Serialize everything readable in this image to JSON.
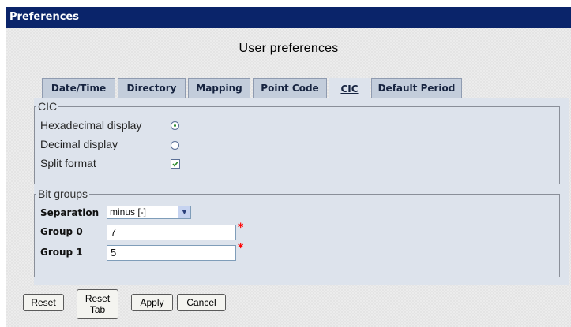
{
  "window": {
    "title": "Preferences"
  },
  "page": {
    "title": "User preferences"
  },
  "tabs": [
    {
      "label": "Date/Time",
      "active": false
    },
    {
      "label": "Directory",
      "active": false
    },
    {
      "label": "Mapping",
      "active": false
    },
    {
      "label": "Point Code",
      "active": false
    },
    {
      "label": "CIC",
      "active": true
    },
    {
      "label": "Default Period",
      "active": false
    }
  ],
  "cic": {
    "legend": "CIC",
    "options": [
      {
        "label": "Hexadecimal display",
        "type": "radio",
        "checked": true
      },
      {
        "label": "Decimal display",
        "type": "radio",
        "checked": false
      },
      {
        "label": "Split format",
        "type": "checkbox",
        "checked": true
      }
    ]
  },
  "bit_groups": {
    "legend": "Bit groups",
    "separation": {
      "label": "Separation",
      "value": "minus [-]"
    },
    "group0": {
      "label": "Group 0",
      "value": "7",
      "required_mark": "*"
    },
    "group1": {
      "label": "Group 1",
      "value": "5",
      "required_mark": "*"
    }
  },
  "buttons": {
    "reset": "Reset",
    "reset_tab_line1": "Reset",
    "reset_tab_line2": "Tab",
    "apply": "Apply",
    "cancel": "Cancel"
  },
  "colors": {
    "title_bar": "#0a246a",
    "tab": "#c3cddb",
    "panel": "#dde3ec",
    "required": "#ff0000",
    "check": "#2a8a2a"
  },
  "icons": {
    "radio_selected": "radio-selected-icon",
    "checkbox_checked": "checkmark-icon",
    "dropdown": "chevron-down-icon"
  }
}
